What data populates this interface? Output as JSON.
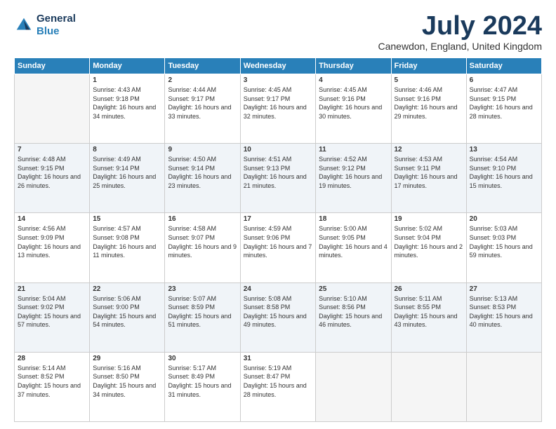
{
  "logo": {
    "line1": "General",
    "line2": "Blue"
  },
  "title": "July 2024",
  "location": "Canewdon, England, United Kingdom",
  "days_header": [
    "Sunday",
    "Monday",
    "Tuesday",
    "Wednesday",
    "Thursday",
    "Friday",
    "Saturday"
  ],
  "weeks": [
    [
      {
        "day": "",
        "sunrise": "",
        "sunset": "",
        "daylight": ""
      },
      {
        "day": "1",
        "sunrise": "Sunrise: 4:43 AM",
        "sunset": "Sunset: 9:18 PM",
        "daylight": "Daylight: 16 hours and 34 minutes."
      },
      {
        "day": "2",
        "sunrise": "Sunrise: 4:44 AM",
        "sunset": "Sunset: 9:17 PM",
        "daylight": "Daylight: 16 hours and 33 minutes."
      },
      {
        "day": "3",
        "sunrise": "Sunrise: 4:45 AM",
        "sunset": "Sunset: 9:17 PM",
        "daylight": "Daylight: 16 hours and 32 minutes."
      },
      {
        "day": "4",
        "sunrise": "Sunrise: 4:45 AM",
        "sunset": "Sunset: 9:16 PM",
        "daylight": "Daylight: 16 hours and 30 minutes."
      },
      {
        "day": "5",
        "sunrise": "Sunrise: 4:46 AM",
        "sunset": "Sunset: 9:16 PM",
        "daylight": "Daylight: 16 hours and 29 minutes."
      },
      {
        "day": "6",
        "sunrise": "Sunrise: 4:47 AM",
        "sunset": "Sunset: 9:15 PM",
        "daylight": "Daylight: 16 hours and 28 minutes."
      }
    ],
    [
      {
        "day": "7",
        "sunrise": "Sunrise: 4:48 AM",
        "sunset": "Sunset: 9:15 PM",
        "daylight": "Daylight: 16 hours and 26 minutes."
      },
      {
        "day": "8",
        "sunrise": "Sunrise: 4:49 AM",
        "sunset": "Sunset: 9:14 PM",
        "daylight": "Daylight: 16 hours and 25 minutes."
      },
      {
        "day": "9",
        "sunrise": "Sunrise: 4:50 AM",
        "sunset": "Sunset: 9:14 PM",
        "daylight": "Daylight: 16 hours and 23 minutes."
      },
      {
        "day": "10",
        "sunrise": "Sunrise: 4:51 AM",
        "sunset": "Sunset: 9:13 PM",
        "daylight": "Daylight: 16 hours and 21 minutes."
      },
      {
        "day": "11",
        "sunrise": "Sunrise: 4:52 AM",
        "sunset": "Sunset: 9:12 PM",
        "daylight": "Daylight: 16 hours and 19 minutes."
      },
      {
        "day": "12",
        "sunrise": "Sunrise: 4:53 AM",
        "sunset": "Sunset: 9:11 PM",
        "daylight": "Daylight: 16 hours and 17 minutes."
      },
      {
        "day": "13",
        "sunrise": "Sunrise: 4:54 AM",
        "sunset": "Sunset: 9:10 PM",
        "daylight": "Daylight: 16 hours and 15 minutes."
      }
    ],
    [
      {
        "day": "14",
        "sunrise": "Sunrise: 4:56 AM",
        "sunset": "Sunset: 9:09 PM",
        "daylight": "Daylight: 16 hours and 13 minutes."
      },
      {
        "day": "15",
        "sunrise": "Sunrise: 4:57 AM",
        "sunset": "Sunset: 9:08 PM",
        "daylight": "Daylight: 16 hours and 11 minutes."
      },
      {
        "day": "16",
        "sunrise": "Sunrise: 4:58 AM",
        "sunset": "Sunset: 9:07 PM",
        "daylight": "Daylight: 16 hours and 9 minutes."
      },
      {
        "day": "17",
        "sunrise": "Sunrise: 4:59 AM",
        "sunset": "Sunset: 9:06 PM",
        "daylight": "Daylight: 16 hours and 7 minutes."
      },
      {
        "day": "18",
        "sunrise": "Sunrise: 5:00 AM",
        "sunset": "Sunset: 9:05 PM",
        "daylight": "Daylight: 16 hours and 4 minutes."
      },
      {
        "day": "19",
        "sunrise": "Sunrise: 5:02 AM",
        "sunset": "Sunset: 9:04 PM",
        "daylight": "Daylight: 16 hours and 2 minutes."
      },
      {
        "day": "20",
        "sunrise": "Sunrise: 5:03 AM",
        "sunset": "Sunset: 9:03 PM",
        "daylight": "Daylight: 15 hours and 59 minutes."
      }
    ],
    [
      {
        "day": "21",
        "sunrise": "Sunrise: 5:04 AM",
        "sunset": "Sunset: 9:02 PM",
        "daylight": "Daylight: 15 hours and 57 minutes."
      },
      {
        "day": "22",
        "sunrise": "Sunrise: 5:06 AM",
        "sunset": "Sunset: 9:00 PM",
        "daylight": "Daylight: 15 hours and 54 minutes."
      },
      {
        "day": "23",
        "sunrise": "Sunrise: 5:07 AM",
        "sunset": "Sunset: 8:59 PM",
        "daylight": "Daylight: 15 hours and 51 minutes."
      },
      {
        "day": "24",
        "sunrise": "Sunrise: 5:08 AM",
        "sunset": "Sunset: 8:58 PM",
        "daylight": "Daylight: 15 hours and 49 minutes."
      },
      {
        "day": "25",
        "sunrise": "Sunrise: 5:10 AM",
        "sunset": "Sunset: 8:56 PM",
        "daylight": "Daylight: 15 hours and 46 minutes."
      },
      {
        "day": "26",
        "sunrise": "Sunrise: 5:11 AM",
        "sunset": "Sunset: 8:55 PM",
        "daylight": "Daylight: 15 hours and 43 minutes."
      },
      {
        "day": "27",
        "sunrise": "Sunrise: 5:13 AM",
        "sunset": "Sunset: 8:53 PM",
        "daylight": "Daylight: 15 hours and 40 minutes."
      }
    ],
    [
      {
        "day": "28",
        "sunrise": "Sunrise: 5:14 AM",
        "sunset": "Sunset: 8:52 PM",
        "daylight": "Daylight: 15 hours and 37 minutes."
      },
      {
        "day": "29",
        "sunrise": "Sunrise: 5:16 AM",
        "sunset": "Sunset: 8:50 PM",
        "daylight": "Daylight: 15 hours and 34 minutes."
      },
      {
        "day": "30",
        "sunrise": "Sunrise: 5:17 AM",
        "sunset": "Sunset: 8:49 PM",
        "daylight": "Daylight: 15 hours and 31 minutes."
      },
      {
        "day": "31",
        "sunrise": "Sunrise: 5:19 AM",
        "sunset": "Sunset: 8:47 PM",
        "daylight": "Daylight: 15 hours and 28 minutes."
      },
      {
        "day": "",
        "sunrise": "",
        "sunset": "",
        "daylight": ""
      },
      {
        "day": "",
        "sunrise": "",
        "sunset": "",
        "daylight": ""
      },
      {
        "day": "",
        "sunrise": "",
        "sunset": "",
        "daylight": ""
      }
    ]
  ]
}
